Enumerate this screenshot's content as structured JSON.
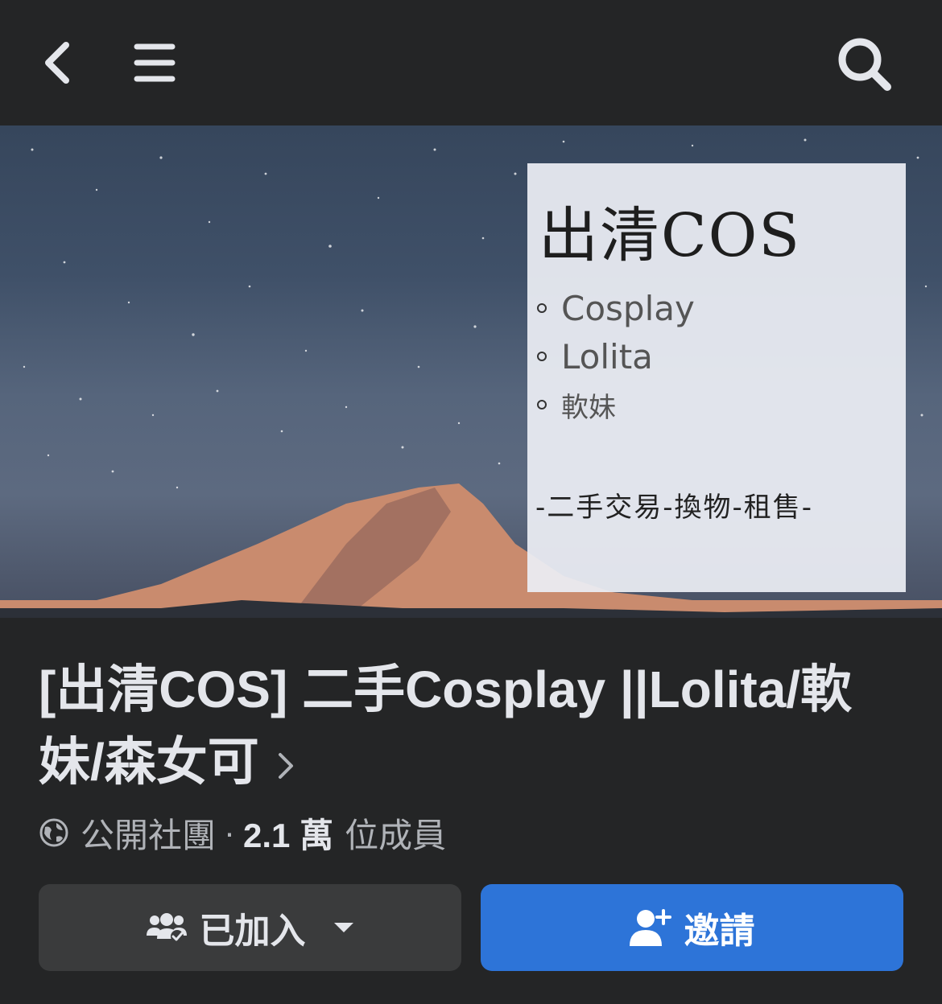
{
  "nav": {
    "back_icon": "chevron-left-icon",
    "menu_icon": "hamburger-menu-icon",
    "search_icon": "search-icon"
  },
  "cover": {
    "title": "出清COS",
    "items": [
      "Cosplay",
      "Lolita",
      "軟妹"
    ],
    "footer": "-二手交易-換物-租售-"
  },
  "group": {
    "title": "[出清COS] 二手Cosplay ||Lolita/軟妹/森女可",
    "privacy": "公開社團",
    "separator": "·",
    "member_count": "2.1 萬",
    "member_suffix": "位成員"
  },
  "actions": {
    "joined_label": "已加入",
    "invite_label": "邀請"
  },
  "colors": {
    "background": "#242526",
    "button_secondary": "#3a3b3c",
    "button_primary": "#2d74d8",
    "text_primary": "#e4e6eb",
    "text_secondary": "#b0b3b8"
  }
}
